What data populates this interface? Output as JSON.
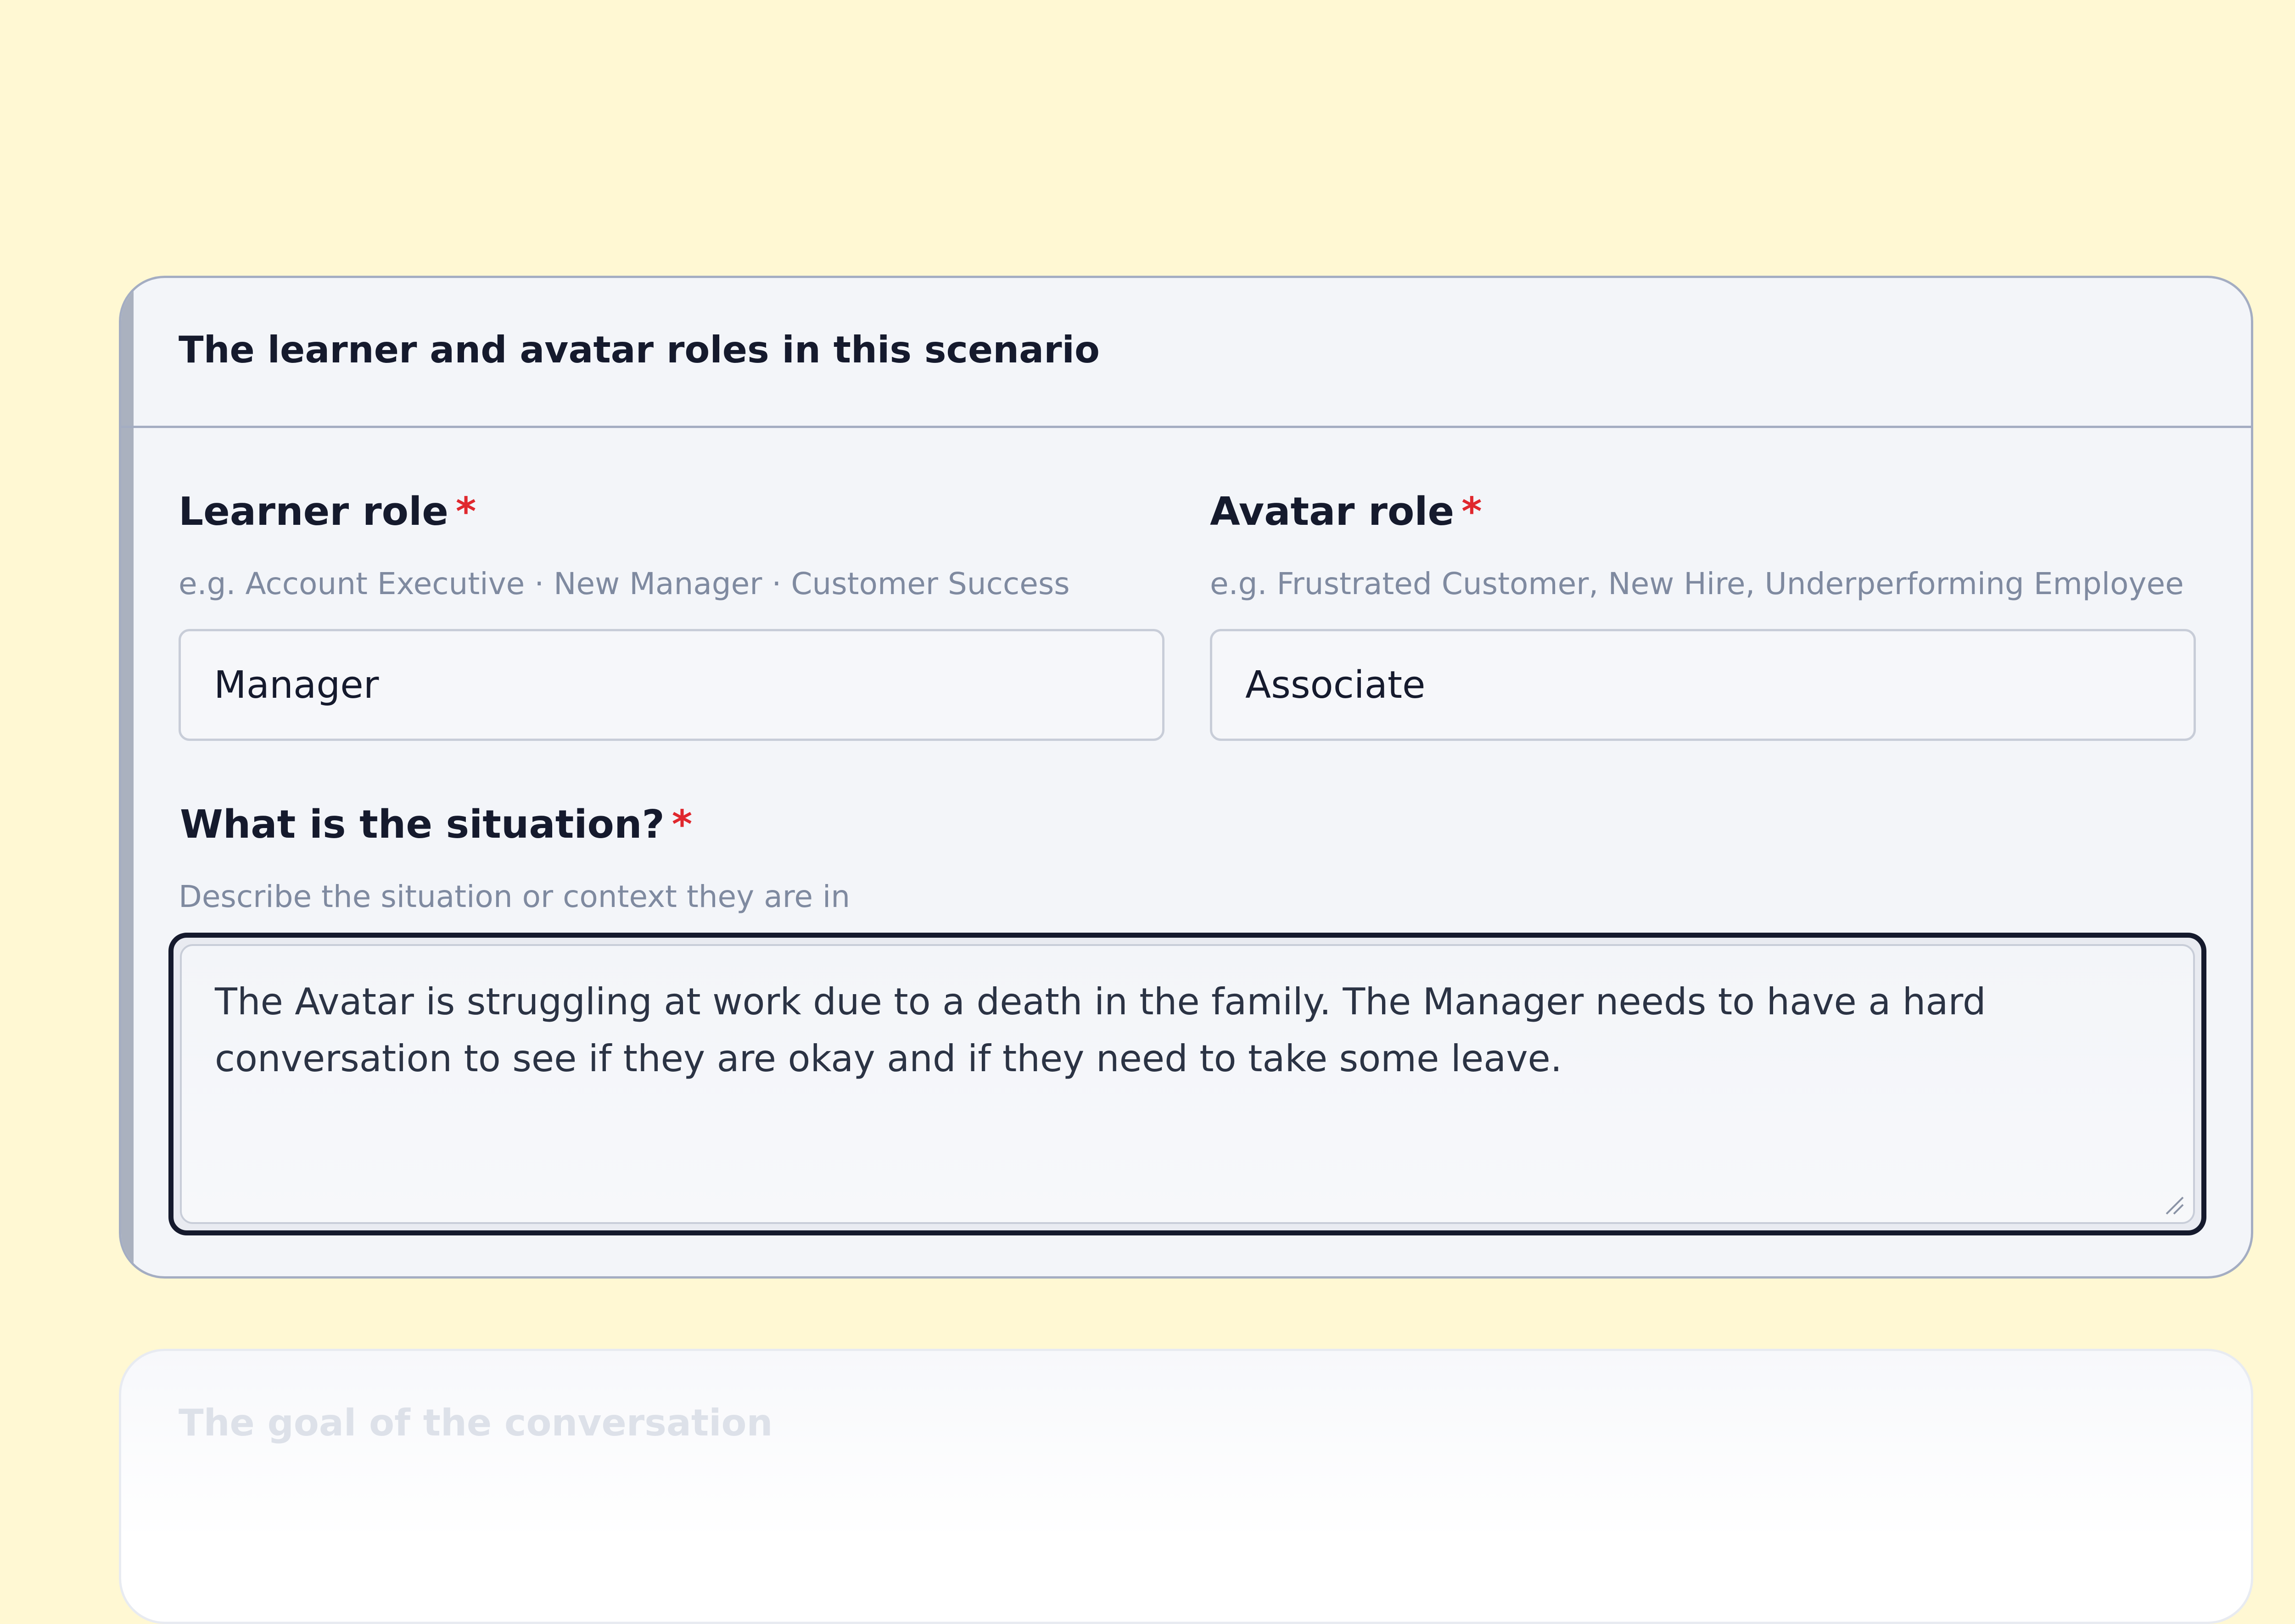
{
  "roles_card": {
    "title": "The learner and avatar roles in this scenario",
    "learner_role": {
      "label": "Learner role",
      "required_marker": "*",
      "hint": "e.g. Account Executive · New Manager · Customer Success",
      "value": "Manager"
    },
    "avatar_role": {
      "label": "Avatar role",
      "required_marker": "*",
      "hint": "e.g. Frustrated Customer, New Hire, Underperforming Employee",
      "value": "Associate"
    },
    "situation": {
      "label": "What is the situation?",
      "required_marker": "*",
      "hint": "Describe the situation or context they are in",
      "value": "The Avatar is struggling at work due to a death in the family. The Manager needs to have a hard conversation to see if they are okay and if they need to take some leave."
    }
  },
  "goal_card": {
    "title": "The goal of the conversation"
  },
  "colors": {
    "background": "#fff8d3",
    "card_background": "#f3f5f9",
    "required_marker": "#e0282e",
    "focus_border": "#151a2d"
  }
}
